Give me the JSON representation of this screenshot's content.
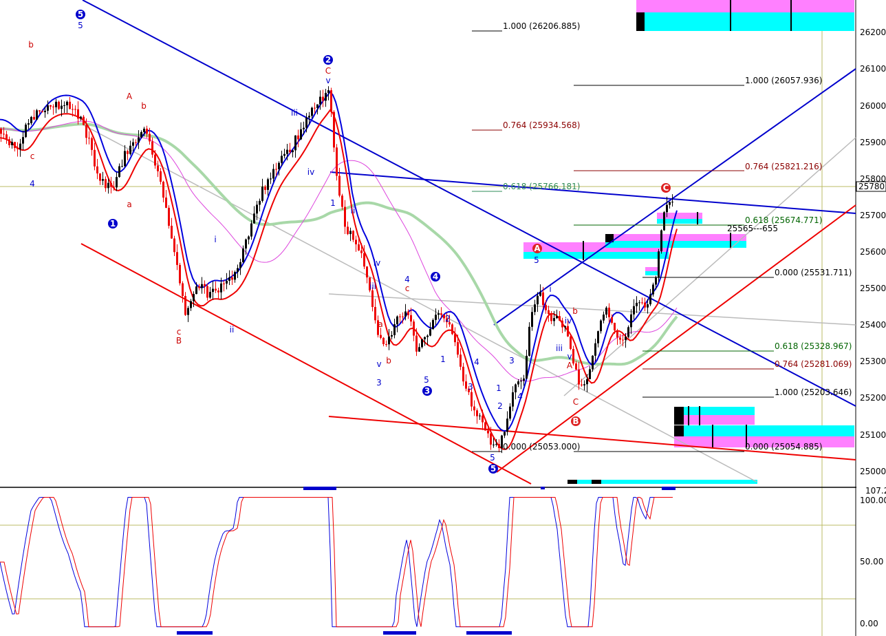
{
  "chart_data": {
    "type": "candlestick",
    "price_axis": {
      "ticks": [
        "26200",
        "26100",
        "26000",
        "25900",
        "25800",
        "25700",
        "25600",
        "25500",
        "25400",
        "25300",
        "25200",
        "25100",
        "25000"
      ],
      "ylim": [
        24960,
        26280
      ],
      "last_price_label": "25780."
    },
    "oscillator_axis": {
      "ticks": [
        "100.00",
        "50.00",
        "0.00"
      ],
      "top_label": "107.2",
      "ylim": [
        -5,
        107.2
      ],
      "reference_lines": [
        20,
        80
      ]
    },
    "fib_levels": [
      {
        "label": "1.000 (26206.885)",
        "value": 26206.885,
        "color": "#000000"
      },
      {
        "label": "1.000 (26057.936)",
        "value": 26057.936,
        "color": "#000000"
      },
      {
        "label": "0.764 (25934.568)",
        "value": 25934.568,
        "color": "#8b0000"
      },
      {
        "label": "0.764 (25821.216)",
        "value": 25821.216,
        "color": "#8b0000"
      },
      {
        "label": "0.618 (25766.181)",
        "value": 25766.181,
        "color": "#2e8b57"
      },
      {
        "label": "0.618 (25674.771)",
        "value": 25674.771,
        "color": "#006400"
      },
      {
        "label": "25565---655",
        "value": 25655,
        "color": "#000000"
      },
      {
        "label": "0.000 (25531.711)",
        "value": 25531.711,
        "color": "#000000"
      },
      {
        "label": "0.618 (25328.967)",
        "value": 25328.967,
        "color": "#006400"
      },
      {
        "label": "0.764 (25281.069)",
        "value": 25281.069,
        "color": "#8b0000"
      },
      {
        "label": "1.000 (25203.646)",
        "value": 25203.646,
        "color": "#000000"
      },
      {
        "label": "0.000 (25054.885)",
        "value": 25054.885,
        "color": "#000000"
      },
      {
        "label": "0.000 (25053.000)",
        "value": 25053.0,
        "color": "#000000"
      }
    ],
    "wave_labels": [
      {
        "t": "5",
        "color": "#0000cc",
        "circled": true
      },
      {
        "t": "5",
        "color": "#0000cc"
      },
      {
        "t": "b",
        "color": "#cc0000"
      },
      {
        "t": "A",
        "color": "#cc0000"
      },
      {
        "t": "b",
        "color": "#cc0000"
      },
      {
        "t": "c",
        "color": "#cc0000"
      },
      {
        "t": "4",
        "color": "#0000cc"
      },
      {
        "t": "a",
        "color": "#cc0000"
      },
      {
        "t": "1",
        "color": "#0000cc",
        "circled": true
      },
      {
        "t": "c",
        "color": "#cc0000"
      },
      {
        "t": "B",
        "color": "#cc0000"
      },
      {
        "t": "i",
        "color": "#0000cc"
      },
      {
        "t": "ii",
        "color": "#0000cc"
      },
      {
        "t": "iii",
        "color": "#0000cc"
      },
      {
        "t": "iv",
        "color": "#0000cc"
      },
      {
        "t": "2",
        "color": "#0000cc",
        "circled": true
      },
      {
        "t": "C",
        "color": "#cc0000"
      },
      {
        "t": "v",
        "color": "#0000cc"
      },
      {
        "t": "1",
        "color": "#0000cc"
      },
      {
        "t": "ii",
        "color": "#0000cc"
      },
      {
        "t": "iv",
        "color": "#0000cc"
      },
      {
        "t": "iii",
        "color": "#0000cc"
      },
      {
        "t": "a",
        "color": "#cc0000"
      },
      {
        "t": "b",
        "color": "#cc0000"
      },
      {
        "t": "v",
        "color": "#0000cc"
      },
      {
        "t": "3",
        "color": "#0000cc"
      },
      {
        "t": "4",
        "color": "#0000cc"
      },
      {
        "t": "c",
        "color": "#cc0000"
      },
      {
        "t": "4",
        "color": "#0000cc",
        "circled": true
      },
      {
        "t": "2",
        "color": "#0000cc"
      },
      {
        "t": "1",
        "color": "#0000cc"
      },
      {
        "t": "5",
        "color": "#0000cc"
      },
      {
        "t": "3",
        "color": "#0000cc",
        "circled": true
      },
      {
        "t": "3",
        "color": "#0000cc"
      },
      {
        "t": "4",
        "color": "#0000cc"
      },
      {
        "t": "1",
        "color": "#0000cc"
      },
      {
        "t": "2",
        "color": "#0000cc"
      },
      {
        "t": "5",
        "color": "#0000cc"
      },
      {
        "t": "5",
        "color": "#0000cc",
        "circled": true
      },
      {
        "t": "3",
        "color": "#0000cc"
      },
      {
        "t": "4",
        "color": "#0000cc"
      },
      {
        "t": "5",
        "color": "#0000cc"
      },
      {
        "t": "i",
        "color": "#0000cc"
      },
      {
        "t": "iv",
        "color": "#0000cc"
      },
      {
        "t": "iii",
        "color": "#0000cc"
      },
      {
        "t": "v",
        "color": "#0000cc"
      },
      {
        "t": "b",
        "color": "#cc0000"
      },
      {
        "t": "A",
        "color": "#cc0000"
      },
      {
        "t": "C",
        "color": "#cc0000"
      },
      {
        "t": "A",
        "color": "#cc0000",
        "circled": true,
        "fill": "#dd2222"
      },
      {
        "t": "B",
        "color": "#cc0000",
        "circled": true,
        "fill": "#dd2222"
      },
      {
        "t": "C",
        "color": "#cc0000",
        "circled": true,
        "fill": "#dd2222"
      }
    ],
    "colors": {
      "up_candle": "#000000",
      "down_candle": "#ee0000",
      "ma_blue": "#0000dd",
      "ma_red": "#ee0000",
      "ma_magenta": "#dd44dd",
      "ma_green": "#a8d8a8",
      "channel_blue": "#0000cc",
      "channel_red": "#ee0000",
      "channel_grey": "#bbbbbb",
      "zone_cyan": "#00ffff",
      "zone_magenta": "#ff80ff",
      "ref_line": "#bbbb66"
    }
  }
}
